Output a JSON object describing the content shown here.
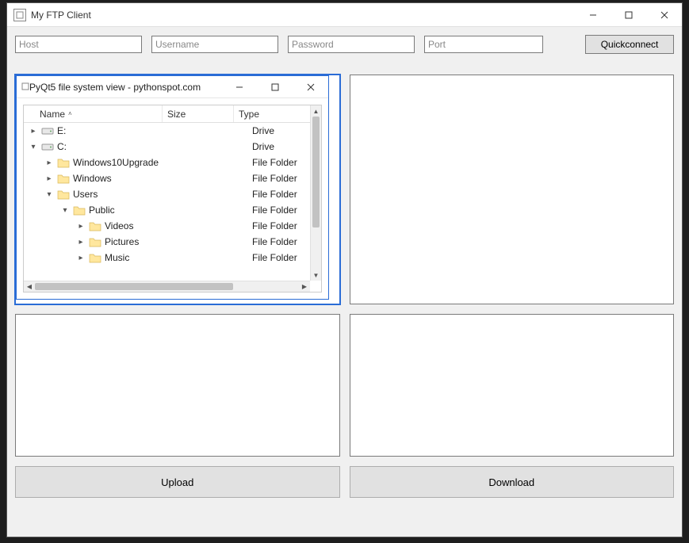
{
  "app": {
    "title": "My FTP Client"
  },
  "connection": {
    "host_placeholder": "Host",
    "username_placeholder": "Username",
    "password_placeholder": "Password",
    "port_placeholder": "Port",
    "quickconnect_label": "Quickconnect"
  },
  "inner_window": {
    "title": "PyQt5 file system view - pythonspot.com"
  },
  "tree": {
    "columns": {
      "name": "Name",
      "size": "Size",
      "type": "Type"
    },
    "items": [
      {
        "indent": 0,
        "twisty": "right",
        "icon": "drive",
        "name": "E:",
        "type": "Drive"
      },
      {
        "indent": 0,
        "twisty": "down",
        "icon": "drive",
        "name": "C:",
        "type": "Drive"
      },
      {
        "indent": 1,
        "twisty": "right",
        "icon": "folder",
        "name": "Windows10Upgrade",
        "type": "File Folder"
      },
      {
        "indent": 1,
        "twisty": "right",
        "icon": "folder",
        "name": "Windows",
        "type": "File Folder"
      },
      {
        "indent": 1,
        "twisty": "down",
        "icon": "folder",
        "name": "Users",
        "type": "File Folder"
      },
      {
        "indent": 2,
        "twisty": "down",
        "icon": "folder",
        "name": "Public",
        "type": "File Folder"
      },
      {
        "indent": 3,
        "twisty": "right",
        "icon": "folder",
        "name": "Videos",
        "type": "File Folder"
      },
      {
        "indent": 3,
        "twisty": "right",
        "icon": "folder",
        "name": "Pictures",
        "type": "File Folder"
      },
      {
        "indent": 3,
        "twisty": "right",
        "icon": "folder",
        "name": "Music",
        "type": "File Folder"
      }
    ]
  },
  "buttons": {
    "upload": "Upload",
    "download": "Download"
  }
}
